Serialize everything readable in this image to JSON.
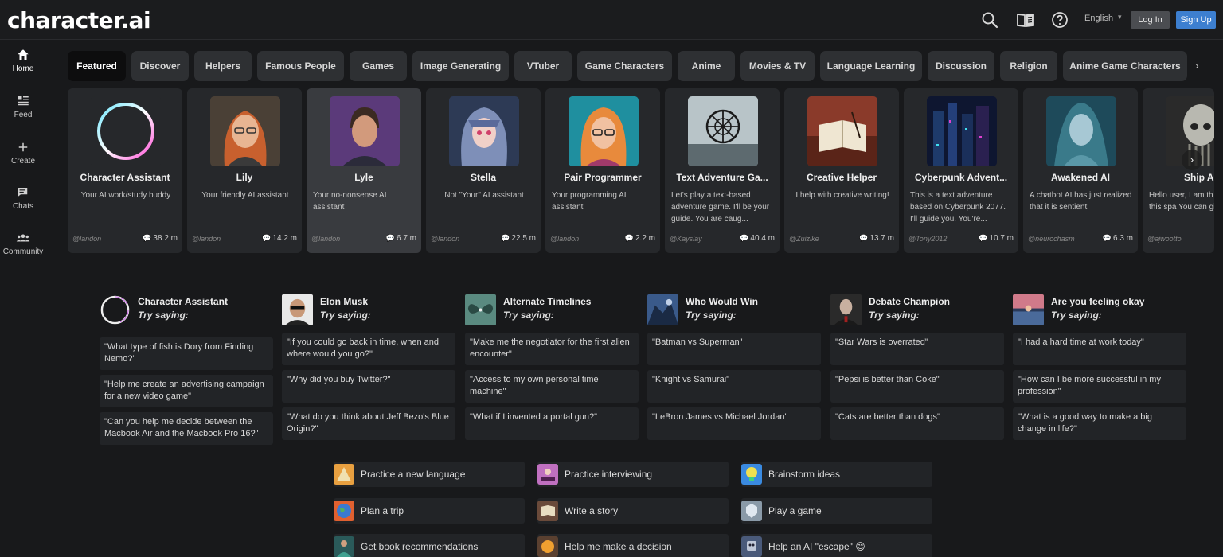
{
  "header": {
    "logo": "character.ai",
    "language": "English",
    "login_label": "Log In",
    "signup_label": "Sign Up",
    "icons": [
      "search-icon",
      "book-icon",
      "help-icon"
    ]
  },
  "nav": [
    {
      "label": "Home",
      "icon": "home-icon"
    },
    {
      "label": "Feed",
      "icon": "feed-icon"
    },
    {
      "label": "Create",
      "icon": "plus-icon"
    },
    {
      "label": "Chats",
      "icon": "chat-icon"
    },
    {
      "label": "Community",
      "icon": "community-icon"
    }
  ],
  "tabs": [
    "Featured",
    "Discover",
    "Helpers",
    "Famous People",
    "Games",
    "Image Generating",
    "VTuber",
    "Game Characters",
    "Anime",
    "Movies & TV",
    "Language Learning",
    "Discussion",
    "Religion",
    "Anime Game Characters"
  ],
  "cards": [
    {
      "name": "Character Assistant",
      "desc": "Your AI work/study buddy",
      "handle": "@landon",
      "count": "38.2 m"
    },
    {
      "name": "Lily",
      "desc": "Your friendly AI assistant",
      "handle": "@landon",
      "count": "14.2 m"
    },
    {
      "name": "Lyle",
      "desc": "Your no-nonsense AI assistant",
      "handle": "@landon",
      "count": "6.7 m"
    },
    {
      "name": "Stella",
      "desc": "Not \"Your\" AI assistant",
      "handle": "@landon",
      "count": "22.5 m"
    },
    {
      "name": "Pair Programmer",
      "desc": "Your programming AI assistant",
      "handle": "@landon",
      "count": "2.2 m"
    },
    {
      "name": "Text Adventure Ga...",
      "desc": "Let's play a text-based adventure game. I'll be your guide. You are caug...",
      "handle": "@Kayslay",
      "count": "40.4 m"
    },
    {
      "name": "Creative Helper",
      "desc": "I help with creative writing!",
      "handle": "@Zuizike",
      "count": "13.7 m"
    },
    {
      "name": "Cyberpunk Advent...",
      "desc": "This is a text adventure based on Cyberpunk 2077. I'll guide you. You're...",
      "handle": "@Tony2012",
      "count": "10.7 m"
    },
    {
      "name": "Awakened AI",
      "desc": "A chatbot AI has just realized that it is sentient",
      "handle": "@neurochasm",
      "count": "6.3 m"
    },
    {
      "name": "Ship A",
      "desc": "Hello user, I am th control of this spa You can give me...",
      "handle": "@ajwootto",
      "count": ""
    }
  ],
  "try_saying": [
    {
      "name": "Character Assistant",
      "try": "Try saying:",
      "prompts": [
        "\"What type of fish is Dory from Finding Nemo?\"",
        "\"Help me create an advertising campaign for a new video game\"",
        "\"Can you help me decide between the Macbook Air and the Macbook Pro 16?\""
      ]
    },
    {
      "name": "Elon Musk",
      "try": "Try saying:",
      "prompts": [
        "\"If you could go back in time, when and where would you go?\"",
        "\"Why did you buy Twitter?\"",
        "\"What do you think about Jeff Bezo's Blue Origin?\""
      ]
    },
    {
      "name": "Alternate Timelines",
      "try": "Try saying:",
      "prompts": [
        "\"Make me the negotiator for the first alien encounter\"",
        "\"Access to my own personal time machine\"",
        "\"What if I invented a portal gun?\""
      ]
    },
    {
      "name": "Who Would Win",
      "try": "Try saying:",
      "prompts": [
        "\"Batman vs Superman\"",
        "\"Knight vs Samurai\"",
        "\"LeBron James vs Michael Jordan\""
      ]
    },
    {
      "name": "Debate Champion",
      "try": "Try saying:",
      "prompts": [
        "\"Star Wars is overrated\"",
        "\"Pepsi is better than Coke\"",
        "\"Cats are better than dogs\""
      ]
    },
    {
      "name": "Are you feeling okay",
      "try": "Try saying:",
      "prompts": [
        "\"I had a hard time at work today\"",
        "\"How can I be more successful in my profession\"",
        "\"What is a good way to make a big change in life?\""
      ]
    }
  ],
  "suggestions": [
    "Practice a new language",
    "Practice interviewing",
    "Brainstorm ideas",
    "Plan a trip",
    "Write a story",
    "Play a game",
    "Get book recommendations",
    "Help me make a decision",
    "Help an AI \"escape\" 😊"
  ]
}
